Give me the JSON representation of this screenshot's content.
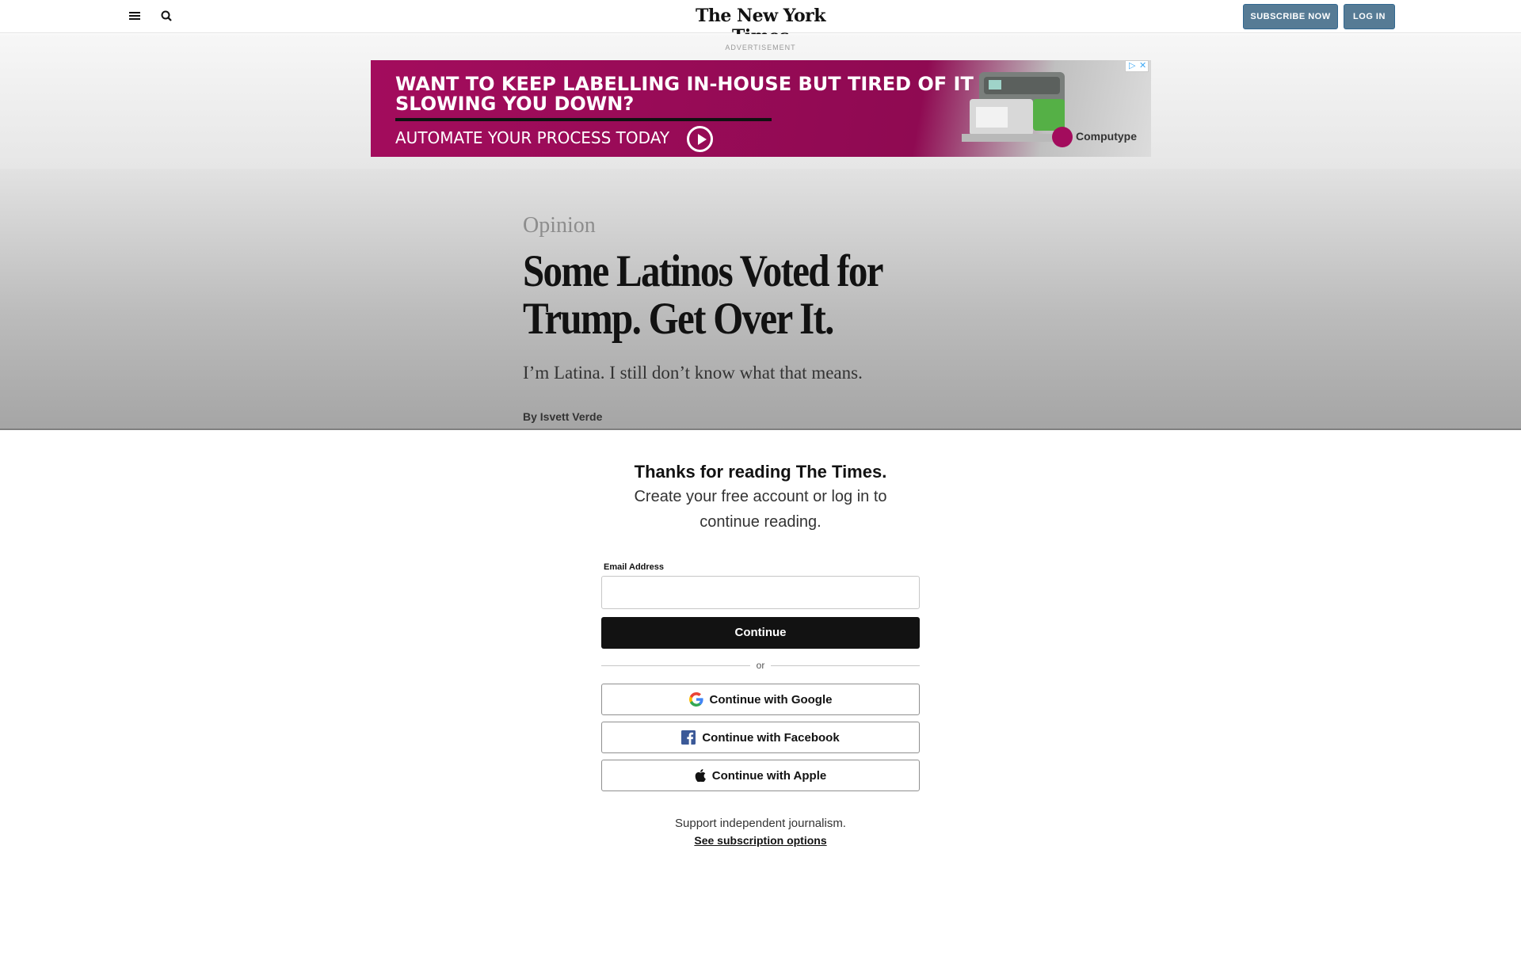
{
  "header": {
    "logo_text": "The New York Times",
    "subscribe_label": "SUBSCRIBE NOW",
    "login_label": "LOG IN",
    "button_color": "#567b95"
  },
  "ad": {
    "label": "ADVERTISEMENT",
    "headline": "WANT TO KEEP LABELLING IN-HOUSE BUT TIRED OF IT SLOWING YOU DOWN?",
    "cta": "AUTOMATE YOUR PROCESS TODAY",
    "brand": "Computype",
    "background_color": "#a30c5d"
  },
  "article": {
    "section": "Opinion",
    "headline": "Some Latinos Voted for Trump. Get Over It.",
    "dek": "I’m Latina. I still don’t know what that means.",
    "byline_prefix": "By",
    "author": "Isvett Verde"
  },
  "regiwall": {
    "title": "Thanks for reading The Times.",
    "subtitle": "Create your free account or log in to continue reading.",
    "email_label": "Email Address",
    "email_value": "",
    "continue_label": "Continue",
    "divider_text": "or",
    "google_label": "Continue with Google",
    "facebook_label": "Continue with Facebook",
    "apple_label": "Continue with Apple",
    "support_text": "Support independent journalism.",
    "subscription_link": "See subscription options"
  }
}
